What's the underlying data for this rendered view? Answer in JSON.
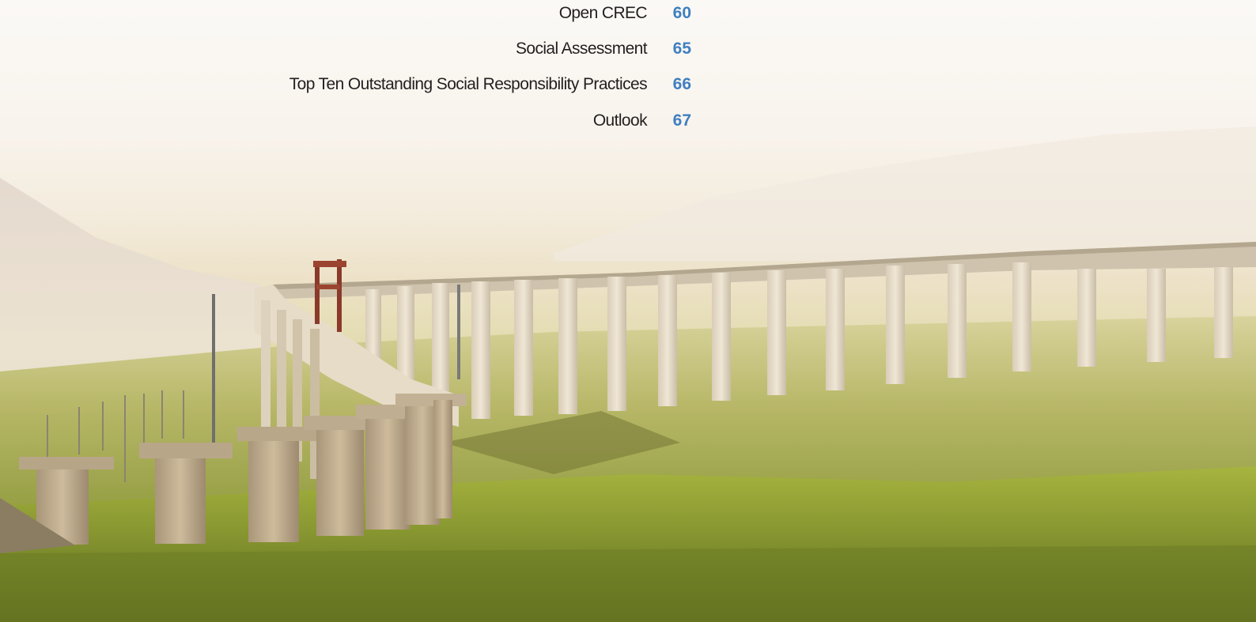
{
  "theme": {
    "accent": "#3f7fc0",
    "text": "#231f20"
  },
  "toc": {
    "entries": [
      {
        "title": "Open CREC",
        "page": "60"
      },
      {
        "title": "Social Assessment",
        "page": "65"
      },
      {
        "title": "Top Ten Outstanding Social Responsibility Practices",
        "page": "66"
      },
      {
        "title": "Outlook",
        "page": "67"
      }
    ]
  },
  "background": {
    "icon": "railway-viaduct-photo"
  }
}
